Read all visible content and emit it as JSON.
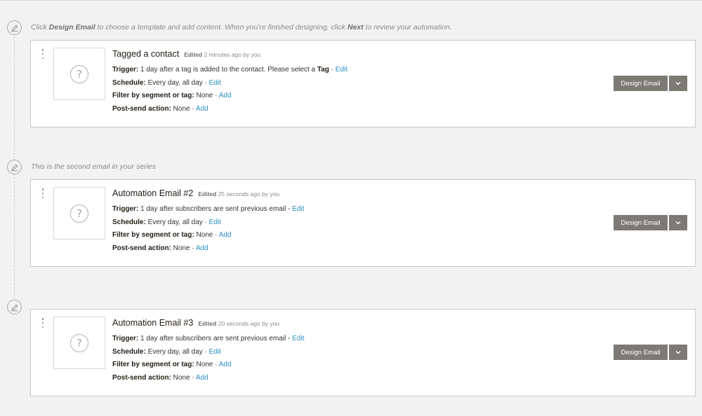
{
  "notes": [
    {
      "prefix": "Click ",
      "bold1": "Design Email",
      "middle": " to choose a template and add content. When you're finished designing, click ",
      "bold2": "Next",
      "suffix": " to review your automation."
    },
    {
      "text": "This is the second email in your series"
    }
  ],
  "emails": [
    {
      "title": "Tagged a contact",
      "edited_label": "Edited",
      "edited_time": "2 minutes ago by you",
      "trigger_label": "Trigger:",
      "trigger_text": " 1 day after a tag is added to the contact. Please select a ",
      "trigger_bold": "Tag",
      "trigger_sep": " · ",
      "trigger_link": "Edit",
      "schedule_label": "Schedule:",
      "schedule_text": " Every day, all day · ",
      "schedule_link": "Edit",
      "filter_label": "Filter by segment or tag:",
      "filter_text": " None · ",
      "filter_link": "Add",
      "postsend_label": "Post-send action:",
      "postsend_text": " None · ",
      "postsend_link": "Add",
      "design_button": "Design Email"
    },
    {
      "title": "Automation Email #2",
      "edited_label": "Edited",
      "edited_time": "25 seconds ago by you",
      "trigger_label": "Trigger:",
      "trigger_text": " 1 day after subscribers are sent previous email - ",
      "trigger_link": "Edit",
      "schedule_label": "Schedule:",
      "schedule_text": " Every day, all day · ",
      "schedule_link": "Edit",
      "filter_label": "Filter by segment or tag:",
      "filter_text": " None · ",
      "filter_link": "Add",
      "postsend_label": "Post-send action:",
      "postsend_text": " None · ",
      "postsend_link": "Add",
      "design_button": "Design Email"
    },
    {
      "title": "Automation Email #3",
      "edited_label": "Edited",
      "edited_time": "20 seconds ago by you",
      "trigger_label": "Trigger:",
      "trigger_text": " 1 day after subscribers are sent previous email - ",
      "trigger_link": "Edit",
      "schedule_label": "Schedule:",
      "schedule_text": " Every day, all day · ",
      "schedule_link": "Edit",
      "filter_label": "Filter by segment or tag:",
      "filter_text": " None · ",
      "filter_link": "Add",
      "postsend_label": "Post-send action:",
      "postsend_text": " None · ",
      "postsend_link": "Add",
      "design_button": "Design Email"
    }
  ],
  "icons": {
    "note": "pencil-circle-icon",
    "menu": "kebab-menu-icon",
    "thumbnail": "question-circle-icon",
    "dropdown": "chevron-down-icon"
  },
  "colors": {
    "link": "#2d8ec4",
    "button": "#7d7a76",
    "background": "#f2f2f2"
  }
}
